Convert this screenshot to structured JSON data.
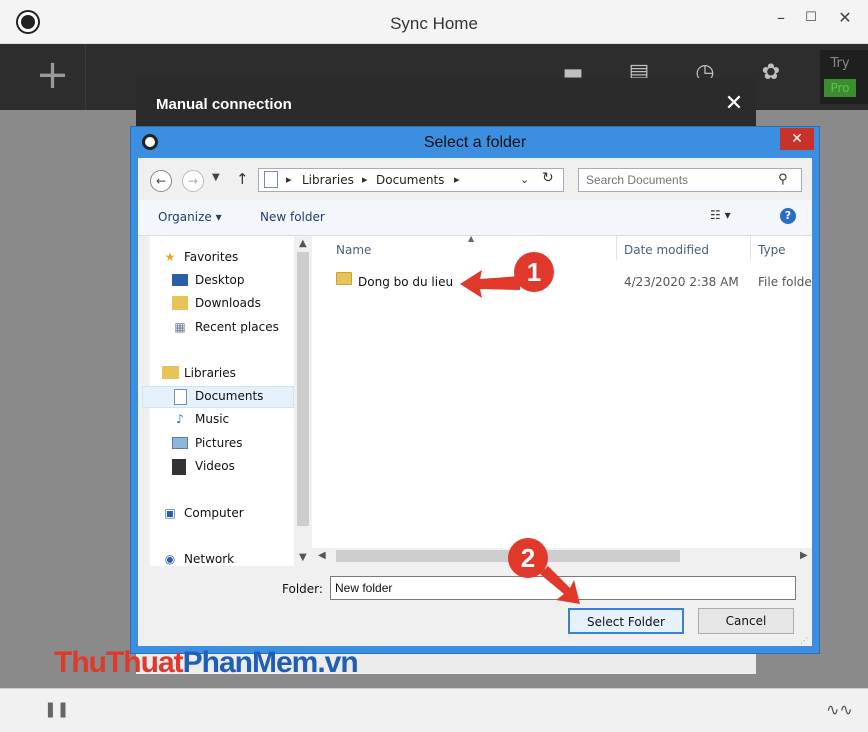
{
  "app": {
    "title": "Sync Home",
    "minimize": "–",
    "maximize": "☐",
    "close": "✕",
    "add": "+",
    "try_label": "Try",
    "pro_label": "Pro"
  },
  "manual": {
    "title": "Manual connection",
    "close": "✕"
  },
  "dialog": {
    "title": "Select a folder",
    "close": "✕",
    "address": {
      "crumbs": [
        "Libraries",
        "Documents"
      ]
    },
    "search": {
      "placeholder": "Search Documents"
    },
    "commands": {
      "organize": "Organize ▾",
      "new_folder": "New folder"
    },
    "nav": {
      "favorites": "Favorites",
      "desktop": "Desktop",
      "downloads": "Downloads",
      "recent": "Recent places",
      "libraries": "Libraries",
      "documents": "Documents",
      "music": "Music",
      "pictures": "Pictures",
      "videos": "Videos",
      "computer": "Computer",
      "network": "Network"
    },
    "columns": {
      "name": "Name",
      "date": "Date modified",
      "type": "Type"
    },
    "rows": [
      {
        "name": "Dong bo du lieu",
        "date": "4/23/2020 2:38 AM",
        "type": "File folder"
      }
    ],
    "folder_label": "Folder:",
    "folder_value": "New folder",
    "buttons": {
      "select": "Select Folder",
      "cancel": "Cancel"
    }
  },
  "annotations": {
    "step1": "1",
    "step2": "2"
  },
  "watermark": {
    "part1": "Thu",
    "part2": "Thuat",
    "part3": "PhanMem",
    "part4": ".vn"
  },
  "colors": {
    "accent": "#3c8fe0",
    "badge": "#e0392c",
    "pro": "#3c8d2f"
  }
}
